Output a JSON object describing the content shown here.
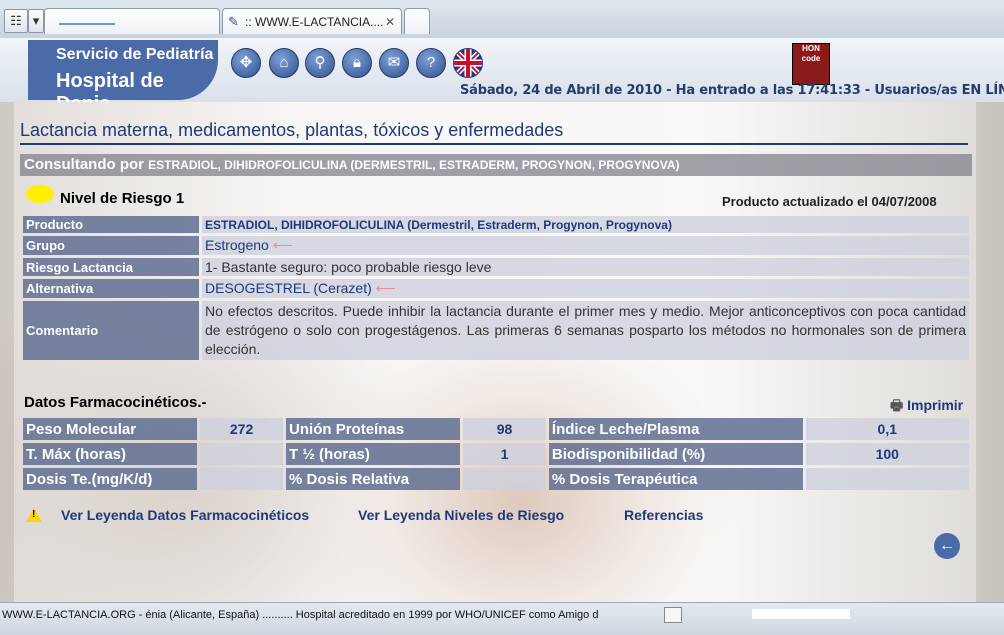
{
  "browser": {
    "tab_title": ":: WWW.E-LACTANCIA....",
    "tab_close": "✕",
    "grid_btn": "☷",
    "dropdown_btn": "▾"
  },
  "header": {
    "logo_line1": "Servicio de Pediatría",
    "logo_line2": "Hospital de Denia",
    "hon_text": "HON code",
    "date_line": "Sábado, 24 de Abril de 2010 - Ha entrado a las 17:41:33 - Usuarios/as EN LÍNEA:",
    "nav_icons": [
      "move-icon",
      "home-icon",
      "search-icon",
      "lock-icon",
      "mail-icon",
      "help-icon",
      "uk-flag-icon"
    ]
  },
  "page": {
    "title": "Lactancia materna, medicamentos, plantas, tóxicos y enfermedades",
    "consult_label": "Consultando por",
    "consult_value": "ESTRADIOL, DIHIDROFOLICULINA (DERMESTRIL, ESTRADERM, PROGYNON, PROGYNOVA)",
    "risk_label": "Nivel de Riesgo 1",
    "risk_color": "#ffef00",
    "updated_label": "Producto actualizado el",
    "updated_date": "04/07/2008"
  },
  "details": {
    "producto_label": "Producto",
    "producto_value": "ESTRADIOL, DIHIDROFOLICULINA (Dermestril, Estraderm, Progynon, Progynova)",
    "grupo_label": "Grupo",
    "grupo_value": "Estrogeno",
    "riesgo_label": "Riesgo Lactancia",
    "riesgo_value": "1- Bastante seguro: poco probable riesgo leve",
    "alternativa_label": "Alternativa",
    "alternativa_value": "DESOGESTREL (Cerazet)",
    "comentario_label": "Comentario",
    "comentario_value": "No efectos descritos. Puede inhibir la lactancia durante el primer mes y medio. Mejor anticonceptivos con poca cantidad de estrógeno o solo con progestágenos. Las primeras 6 semanas posparto los métodos no hormonales son de primera elección."
  },
  "pk": {
    "title": "Datos Farmacocinéticos.-",
    "print": "Imprimir",
    "peso_label": "Peso Molecular",
    "peso_value": "272",
    "union_label": "Unión Proteínas",
    "union_value": "98",
    "indice_label": "Índice Leche/Plasma",
    "indice_value": "0,1",
    "tmax_label": "T. Máx (horas)",
    "tmax_value": "",
    "thalf_label": "T ½ (horas)",
    "thalf_value": "1",
    "bio_label": "Biodisponibilidad (%)",
    "bio_value": "100",
    "dosis_label": "Dosis Te.(mg/K/d)",
    "dosis_value": "",
    "rel_label": "% Dosis Relativa",
    "rel_value": "",
    "ter_label": "% Dosis Terapéutica",
    "ter_value": ""
  },
  "links": {
    "leyenda_pk": "Ver Leyenda Datos Farmacocinéticos",
    "leyenda_riesgo": "Ver Leyenda Niveles de Riesgo",
    "referencias": "Referencias"
  },
  "statusbar": {
    "text": "WWW.E-LACTANCIA.ORG -  énia (Alicante, España) .......... Hospital acreditado en 1999 por WHO/UNICEF como Amigo d"
  }
}
